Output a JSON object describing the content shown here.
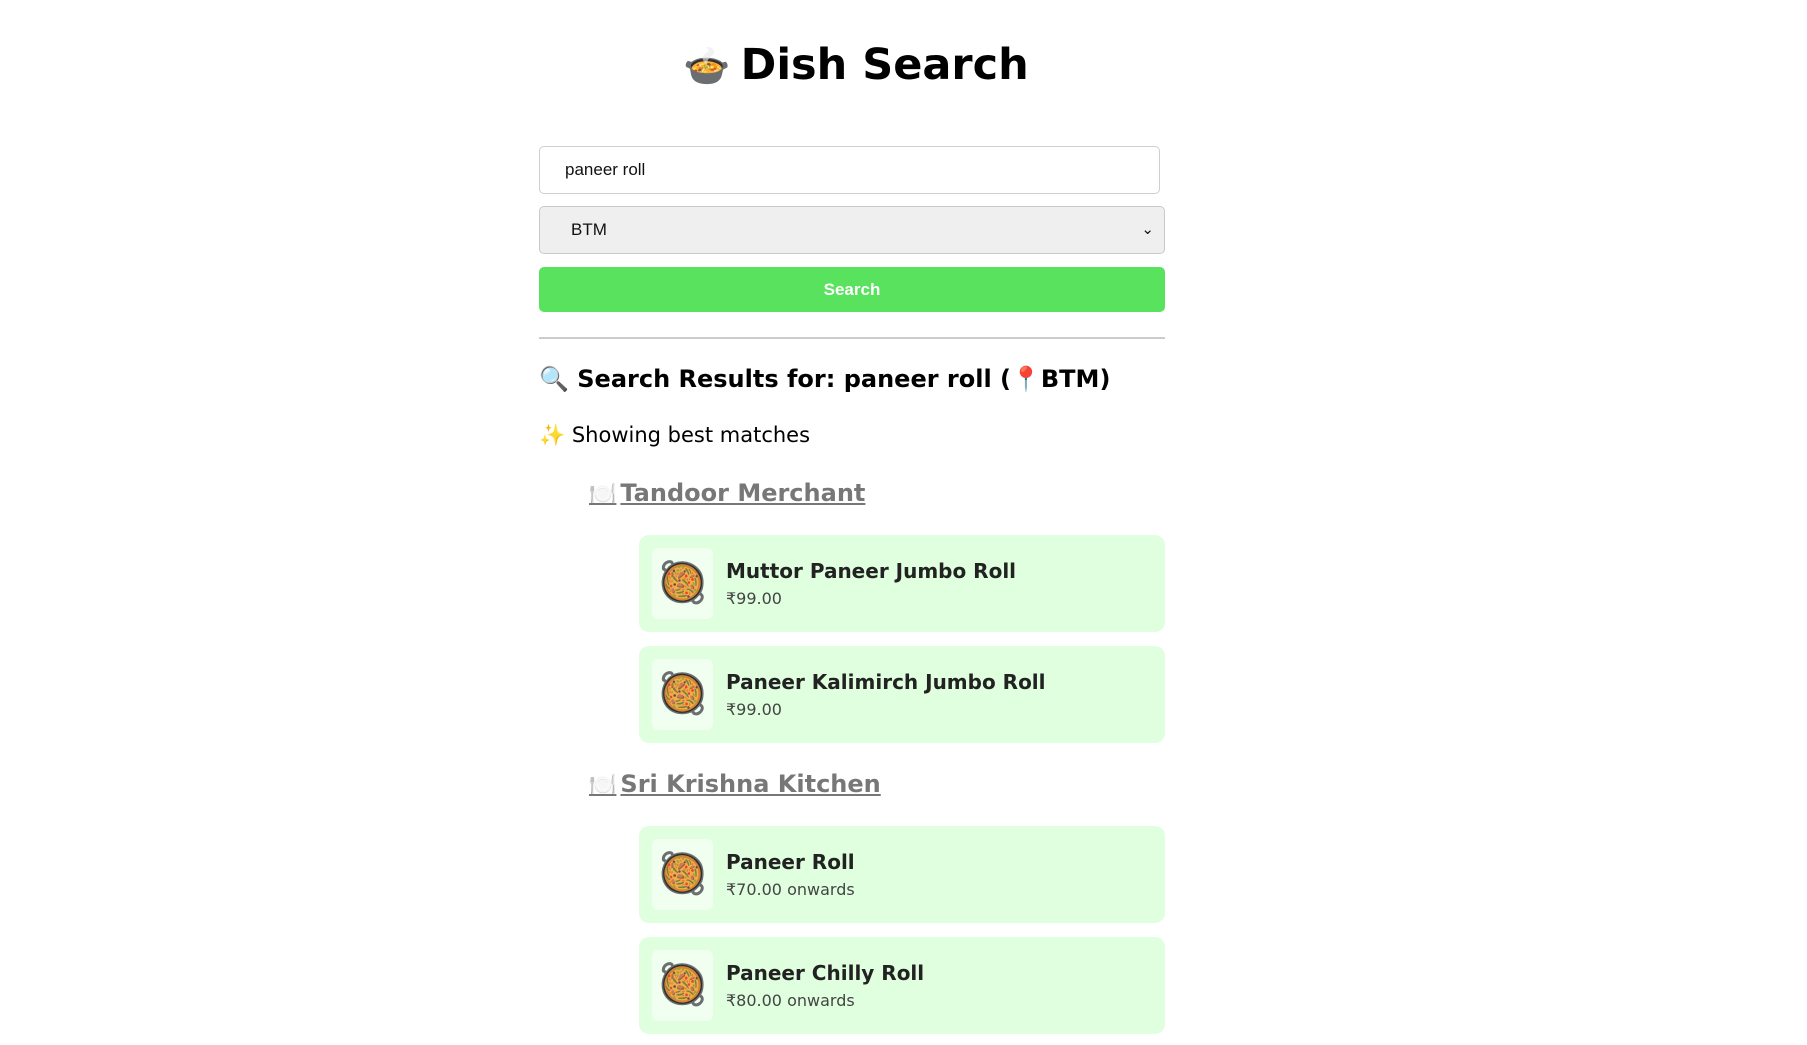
{
  "header": {
    "title_icon": "🍲",
    "title": "Dish Search"
  },
  "search": {
    "query": "paneer roll",
    "location": "BTM",
    "button_label": "Search"
  },
  "results": {
    "heading_icon": "🔍",
    "heading": "Search Results for: paneer roll (📍BTM)",
    "best_icon": "✨",
    "best_text": "Showing best matches",
    "restaurant_icon": "🍽️",
    "dish_icon": "🥘",
    "restaurants": [
      {
        "name": "Tandoor Merchant",
        "dishes": [
          {
            "name": "Muttor Paneer Jumbo Roll",
            "price": "₹99.00"
          },
          {
            "name": "Paneer Kalimirch Jumbo Roll",
            "price": "₹99.00"
          }
        ]
      },
      {
        "name": "Sri Krishna Kitchen",
        "dishes": [
          {
            "name": "Paneer Roll",
            "price": "₹70.00 onwards"
          },
          {
            "name": "Paneer Chilly Roll",
            "price": "₹80.00 onwards"
          }
        ]
      }
    ]
  },
  "colors": {
    "search_button": "#58e25e",
    "dish_card_bg": "#dfffdf",
    "restaurant_link": "#777777"
  }
}
